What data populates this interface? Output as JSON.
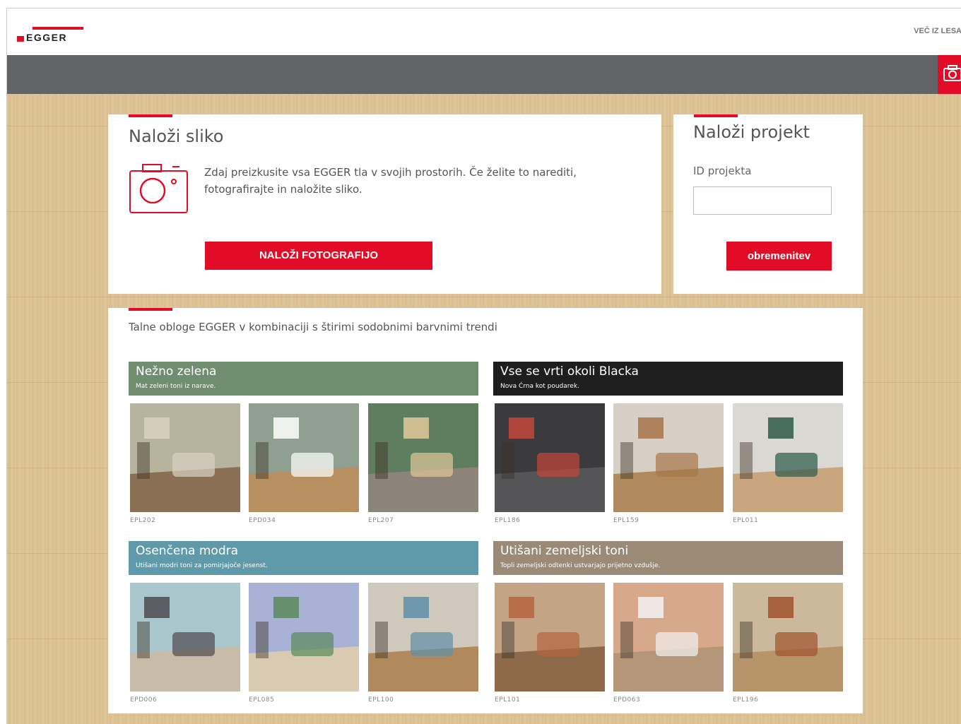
{
  "header": {
    "brand": "EGGER",
    "more_link": "VEČ IZ LESA"
  },
  "upload_card": {
    "title": "Naloži sliko",
    "description": "Zdaj preizkusite vsa EGGER tla v svojih prostorih. Če želite to narediti, fotografirajte in naložite sliko.",
    "button_label": "NALOŽI FOTOGRAFIJO"
  },
  "project_card": {
    "title": "Naloži projekt",
    "id_label": "ID projekta",
    "id_value": "",
    "button_label": "obremenitev"
  },
  "trends": {
    "intro": "Talne obloge EGGER v kombinaciji s štirimi sodobnimi barvnimi trendi",
    "items": [
      {
        "name": "Nežno zelena",
        "subtitle": "Mat zeleni toni iz narave.",
        "color": "#6f8d6f",
        "photos": [
          {
            "code": "EPL202",
            "palette": [
              "#b6b49d",
              "#8a6f55",
              "#d8d2c2"
            ]
          },
          {
            "code": "EPD034",
            "palette": [
              "#8fa090",
              "#b78f60",
              "#ffffff"
            ]
          },
          {
            "code": "EPL207",
            "palette": [
              "#5f7d5f",
              "#8c8478",
              "#e0c89a"
            ]
          }
        ]
      },
      {
        "name": "Vse se vrti okoli Blacka",
        "subtitle": "Nova Ćrna kot poudarek.",
        "color": "#1e1e1e",
        "photos": [
          {
            "code": "EPL186",
            "palette": [
              "#3b3a3d",
              "#555558",
              "#c4473a"
            ]
          },
          {
            "code": "EPL159",
            "palette": [
              "#d6cfc6",
              "#b08a5c",
              "#a77648"
            ]
          },
          {
            "code": "EPL011",
            "palette": [
              "#dad8d2",
              "#c9a57e",
              "#2c5a4a"
            ]
          }
        ]
      },
      {
        "name": "Osenčena modra",
        "subtitle": "Utišani modri toni za pomirjajoče jesenst.",
        "color": "#5f9aaa",
        "photos": [
          {
            "code": "EPD006",
            "palette": [
              "#a9c7cc",
              "#c8bca9",
              "#4f4a4f"
            ]
          },
          {
            "code": "EPL085",
            "palette": [
              "#a8b2d6",
              "#d9cbb2",
              "#5a8a5a"
            ]
          },
          {
            "code": "EPL100",
            "palette": [
              "#cfc9bd",
              "#b08a5c",
              "#5e8fa8"
            ]
          }
        ]
      },
      {
        "name": "Utišani zemeljski toni",
        "subtitle": "Topli zemeljski odtenki ustvarjajo prijetno vzdušje.",
        "color": "#9b8a76",
        "photos": [
          {
            "code": "EPL101",
            "palette": [
              "#c3a585",
              "#8e6a4a",
              "#b6653c"
            ]
          },
          {
            "code": "EPD063",
            "palette": [
              "#d7a98a",
              "#b69678",
              "#f2f2f2"
            ]
          },
          {
            "code": "EPL196",
            "palette": [
              "#ccb89a",
              "#b8946a",
              "#a0522d"
            ]
          }
        ]
      }
    ]
  }
}
